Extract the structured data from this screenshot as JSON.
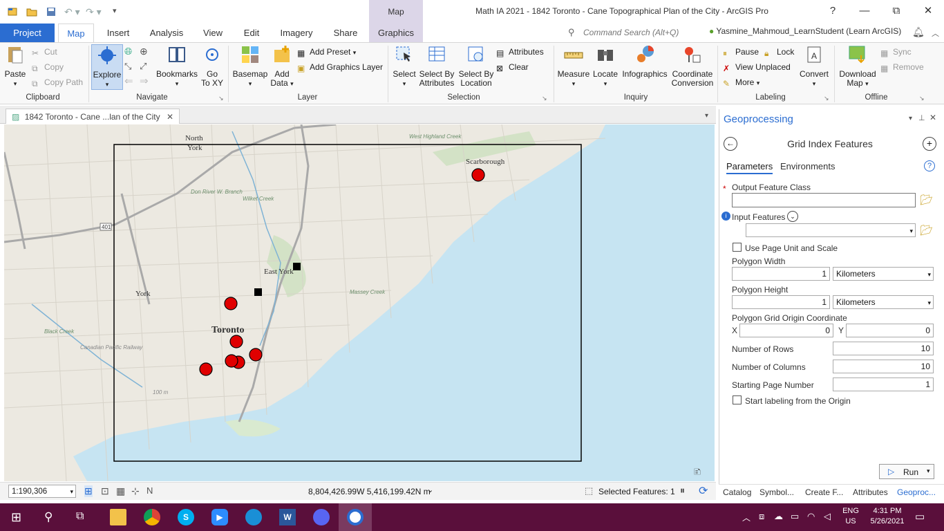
{
  "titlebar": {
    "title": "Math IA 2021 - 1842 Toronto - Cane Topographical Plan of the City - ArcGIS Pro",
    "context_tab_header": "Map",
    "help": "?",
    "min": "—",
    "restore": "⧉",
    "close": "✕"
  },
  "tabs": {
    "project": "Project",
    "map": "Map",
    "insert": "Insert",
    "analysis": "Analysis",
    "view": "View",
    "edit": "Edit",
    "imagery": "Imagery",
    "share": "Share",
    "graphics": "Graphics"
  },
  "command_search": {
    "placeholder": "Command Search (Alt+Q)"
  },
  "user": {
    "name": "Yasmine_Mahmoud_LearnStudent (Learn ArcGIS)"
  },
  "ribbon": {
    "clipboard": {
      "label": "Clipboard",
      "paste": "Paste",
      "cut": "Cut",
      "copy": "Copy",
      "copy_path": "Copy Path"
    },
    "navigate": {
      "label": "Navigate",
      "explore": "Explore",
      "bookmarks": "Bookmarks",
      "goto1": "Go",
      "goto2": "To XY"
    },
    "layer": {
      "label": "Layer",
      "basemap": "Basemap",
      "add_data1": "Add",
      "add_data2": "Data",
      "add_preset": "Add Preset",
      "add_graphics_layer": "Add Graphics Layer"
    },
    "selection": {
      "label": "Selection",
      "select": "Select",
      "sba1": "Select By",
      "sba2": "Attributes",
      "sbl1": "Select By",
      "sbl2": "Location",
      "attributes": "Attributes",
      "clear": "Clear"
    },
    "inquiry": {
      "label": "Inquiry",
      "measure": "Measure",
      "locate": "Locate",
      "infographics": "Infographics",
      "cc1": "Coordinate",
      "cc2": "Conversion"
    },
    "labeling": {
      "label": "Labeling",
      "pause": "Pause",
      "lock": "Lock",
      "view_unplaced": "View Unplaced",
      "more": "More",
      "convert": "Convert"
    },
    "offline": {
      "label": "Offline",
      "dl1": "Download",
      "dl2": "Map",
      "sync": "Sync",
      "remove": "Remove"
    }
  },
  "map_view": {
    "tab_title": "1842 Toronto - Cane ...lan of the City",
    "labels": {
      "north_york": "North York",
      "scarborough": "Scarborough",
      "east_york": "East York",
      "york": "York",
      "toronto": "Toronto",
      "hwy401": "401",
      "massey": "Massey Creek",
      "wilket": "Wilket Creek",
      "donriver": "Don River W. Branch",
      "highland": "West Highland Creek",
      "black": "Black Creek",
      "cpr": "Canadian Pacific Railway",
      "elev": "100 m"
    }
  },
  "status": {
    "scale": "1:190,306",
    "coords": "8,804,426.99W 5,416,199.42N m",
    "selected": "Selected Features: 1"
  },
  "geoprocessing": {
    "pane_title": "Geoprocessing",
    "tool_title": "Grid Index Features",
    "tab_parameters": "Parameters",
    "tab_environments": "Environments",
    "output_feature_class": {
      "label": "Output Feature Class",
      "value": ""
    },
    "input_features": {
      "label": "Input Features",
      "value": ""
    },
    "use_page_unit": {
      "label": "Use Page Unit and Scale",
      "checked": false
    },
    "polygon_width": {
      "label": "Polygon Width",
      "value": "1",
      "unit": "Kilometers"
    },
    "polygon_height": {
      "label": "Polygon Height",
      "value": "1",
      "unit": "Kilometers"
    },
    "origin": {
      "label": "Polygon Grid Origin Coordinate",
      "x_label": "X",
      "x": "0",
      "y_label": "Y",
      "y": "0"
    },
    "rows": {
      "label": "Number of Rows",
      "value": "10"
    },
    "cols": {
      "label": "Number of Columns",
      "value": "10"
    },
    "start_page": {
      "label": "Starting Page Number",
      "value": "1"
    },
    "start_label_origin": {
      "label": "Start labeling from the Origin",
      "checked": false
    },
    "run": "Run"
  },
  "pane_tabs": [
    "Catalog",
    "Symbol...",
    "Create F...",
    "Attributes",
    "Geoproc..."
  ],
  "taskbar": {
    "lang1": "ENG",
    "lang2": "US",
    "time": "4:31 PM",
    "date": "5/26/2021"
  },
  "colors": {
    "accent": "#2b6dd1",
    "water": "#c6e4f2",
    "marker_red": "#e00000",
    "taskbar": "#5a0f3b"
  }
}
